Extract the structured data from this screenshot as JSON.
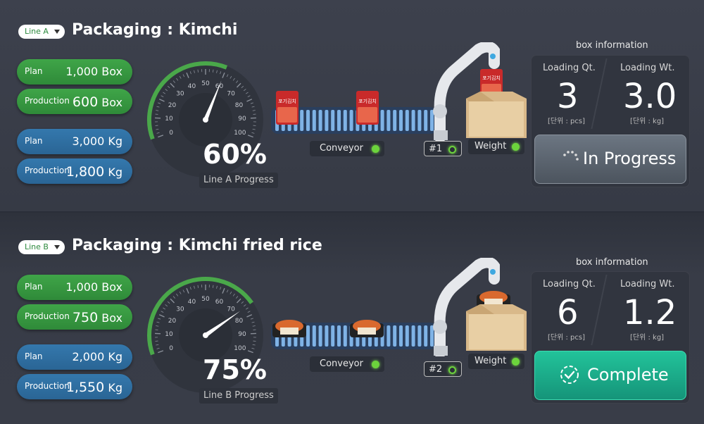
{
  "lines": [
    {
      "selector": "Line A",
      "title": "Packaging : Kimchi",
      "plan_box_label": "Plan",
      "plan_box_value": "1,000",
      "plan_box_unit": "Box",
      "prod_box_label": "Production",
      "prod_box_value": "600",
      "prod_box_unit": "Box",
      "plan_kg_label": "Plan",
      "plan_kg_value": "3,000",
      "plan_kg_unit": "Kg",
      "prod_kg_label": "Production",
      "prod_kg_value": "1,800",
      "prod_kg_unit": "Kg",
      "progress": 0.6,
      "progress_text": "60%",
      "progress_label": "Line A  Progress",
      "gauge_ticks": [
        "0",
        "10",
        "20",
        "30",
        "40",
        "50",
        "60",
        "70",
        "80",
        "90",
        "100"
      ],
      "conveyor_label": "Conveyor",
      "robot_label": "#1",
      "weight_label": "Weight",
      "product_label": "포기김치",
      "box_info_header": "box information",
      "loading_qt_label": "Loading Qt.",
      "loading_qt_value": "3",
      "loading_qt_unit": "[단위 : pcs]",
      "loading_wt_label": "Loading Wt.",
      "loading_wt_value": "3.0",
      "loading_wt_unit": "[단위 : kg]",
      "status": "In Progress",
      "status_type": "progress",
      "status_icon": "spinner-icon"
    },
    {
      "selector": "Line B",
      "title": "Packaging : Kimchi fried rice",
      "plan_box_label": "Plan",
      "plan_box_value": "1,000",
      "plan_box_unit": "Box",
      "prod_box_label": "Production",
      "prod_box_value": "750",
      "prod_box_unit": "Box",
      "plan_kg_label": "Plan",
      "plan_kg_value": "2,000",
      "plan_kg_unit": "Kg",
      "prod_kg_label": "Production",
      "prod_kg_value": "1,550",
      "prod_kg_unit": "Kg",
      "progress": 0.75,
      "progress_text": "75%",
      "progress_label": "Line B  Progress",
      "gauge_ticks": [
        "0",
        "10",
        "20",
        "30",
        "40",
        "50",
        "60",
        "70",
        "80",
        "90",
        "100"
      ],
      "conveyor_label": "Conveyor",
      "robot_label": "#2",
      "weight_label": "Weight",
      "product_label": "",
      "box_info_header": "box information",
      "loading_qt_label": "Loading Qt.",
      "loading_qt_value": "6",
      "loading_qt_unit": "[단위 : pcs]",
      "loading_wt_label": "Loading Wt.",
      "loading_wt_value": "1.2",
      "loading_wt_unit": "[단위 : kg]",
      "status": "Complete",
      "status_type": "done",
      "status_icon": "check-circle-icon"
    }
  ],
  "colors": {
    "green": "#3fa548",
    "blue": "#3478ad",
    "gauge_arc": "#4aa84a",
    "status_dot": "#6cd43c",
    "complete": "#22c39a"
  }
}
